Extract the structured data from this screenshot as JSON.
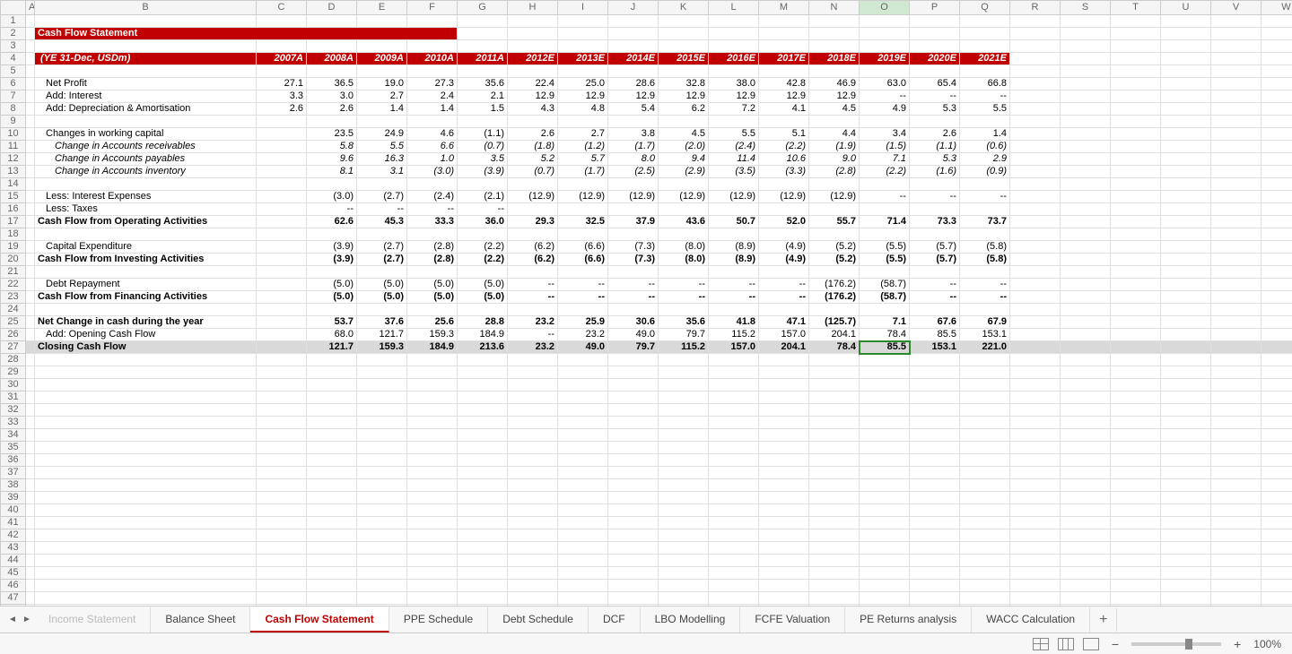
{
  "title": "Cash Flow Statement",
  "header_label": "(YE 31-Dec, USDm)",
  "years": [
    "2007A",
    "2008A",
    "2009A",
    "2010A",
    "2011A",
    "2012E",
    "2013E",
    "2014E",
    "2015E",
    "2016E",
    "2017E",
    "2018E",
    "2019E",
    "2020E",
    "2021E"
  ],
  "rows": [
    {
      "r": 6,
      "label": "Net Profit",
      "indent": 1,
      "vals": [
        "27.1",
        "36.5",
        "19.0",
        "27.3",
        "35.6",
        "22.4",
        "25.0",
        "28.6",
        "32.8",
        "38.0",
        "42.8",
        "46.9",
        "63.0",
        "65.4",
        "66.8"
      ]
    },
    {
      "r": 7,
      "label": "Add: Interest",
      "indent": 1,
      "vals": [
        "3.3",
        "3.0",
        "2.7",
        "2.4",
        "2.1",
        "12.9",
        "12.9",
        "12.9",
        "12.9",
        "12.9",
        "12.9",
        "12.9",
        "--",
        "--",
        "--"
      ]
    },
    {
      "r": 8,
      "label": "Add: Depreciation & Amortisation",
      "indent": 1,
      "vals": [
        "2.6",
        "2.6",
        "1.4",
        "1.4",
        "1.5",
        "4.3",
        "4.8",
        "5.4",
        "6.2",
        "7.2",
        "4.1",
        "4.5",
        "4.9",
        "5.3",
        "5.5"
      ]
    },
    {
      "r": 9,
      "blank": true
    },
    {
      "r": 10,
      "label": "Changes in working capital",
      "indent": 1,
      "vals": [
        "",
        "23.5",
        "24.9",
        "4.6",
        "(1.1)",
        "2.6",
        "2.7",
        "3.8",
        "4.5",
        "5.5",
        "5.1",
        "4.4",
        "3.4",
        "2.6",
        "1.4"
      ]
    },
    {
      "r": 11,
      "label": "Change in Accounts receivables",
      "indent": 2,
      "italic": true,
      "vals": [
        "",
        "5.8",
        "5.5",
        "6.6",
        "(0.7)",
        "(1.8)",
        "(1.2)",
        "(1.7)",
        "(2.0)",
        "(2.4)",
        "(2.2)",
        "(1.9)",
        "(1.5)",
        "(1.1)",
        "(0.6)"
      ]
    },
    {
      "r": 12,
      "label": "Change in Accounts payables",
      "indent": 2,
      "italic": true,
      "vals": [
        "",
        "9.6",
        "16.3",
        "1.0",
        "3.5",
        "5.2",
        "5.7",
        "8.0",
        "9.4",
        "11.4",
        "10.6",
        "9.0",
        "7.1",
        "5.3",
        "2.9"
      ]
    },
    {
      "r": 13,
      "label": "Change in Accounts inventory",
      "indent": 2,
      "italic": true,
      "vals": [
        "",
        "8.1",
        "3.1",
        "(3.0)",
        "(3.9)",
        "(0.7)",
        "(1.7)",
        "(2.5)",
        "(2.9)",
        "(3.5)",
        "(3.3)",
        "(2.8)",
        "(2.2)",
        "(1.6)",
        "(0.9)"
      ]
    },
    {
      "r": 14,
      "blank": true
    },
    {
      "r": 15,
      "label": "Less: Interest Expenses",
      "indent": 1,
      "vals": [
        "",
        "(3.0)",
        "(2.7)",
        "(2.4)",
        "(2.1)",
        "(12.9)",
        "(12.9)",
        "(12.9)",
        "(12.9)",
        "(12.9)",
        "(12.9)",
        "(12.9)",
        "--",
        "--",
        "--"
      ]
    },
    {
      "r": 16,
      "label": "Less: Taxes",
      "indent": 1,
      "vals": [
        "",
        "--",
        "--",
        "--",
        "--",
        "",
        "",
        "",
        "",
        "",
        "",
        "",
        "",
        "",
        ""
      ]
    },
    {
      "r": 17,
      "label": "Cash Flow from Operating Activities",
      "bold": true,
      "topline": true,
      "vals": [
        "",
        "62.6",
        "45.3",
        "33.3",
        "36.0",
        "29.3",
        "32.5",
        "37.9",
        "43.6",
        "50.7",
        "52.0",
        "55.7",
        "71.4",
        "73.3",
        "73.7"
      ]
    },
    {
      "r": 18,
      "blank": true
    },
    {
      "r": 19,
      "label": "Capital Expenditure",
      "indent": 1,
      "vals": [
        "",
        "(3.9)",
        "(2.7)",
        "(2.8)",
        "(2.2)",
        "(6.2)",
        "(6.6)",
        "(7.3)",
        "(8.0)",
        "(8.9)",
        "(4.9)",
        "(5.2)",
        "(5.5)",
        "(5.7)",
        "(5.8)"
      ]
    },
    {
      "r": 20,
      "label": "Cash Flow from Investing Activities",
      "bold": true,
      "topline": true,
      "vals": [
        "",
        "(3.9)",
        "(2.7)",
        "(2.8)",
        "(2.2)",
        "(6.2)",
        "(6.6)",
        "(7.3)",
        "(8.0)",
        "(8.9)",
        "(4.9)",
        "(5.2)",
        "(5.5)",
        "(5.7)",
        "(5.8)"
      ]
    },
    {
      "r": 21,
      "blank": true
    },
    {
      "r": 22,
      "label": "Debt Repayment",
      "indent": 1,
      "vals": [
        "",
        "(5.0)",
        "(5.0)",
        "(5.0)",
        "(5.0)",
        "--",
        "--",
        "--",
        "--",
        "--",
        "--",
        "(176.2)",
        "(58.7)",
        "--",
        "--"
      ]
    },
    {
      "r": 23,
      "label": "Cash Flow from Financing Activities",
      "bold": true,
      "topline": true,
      "vals": [
        "",
        "(5.0)",
        "(5.0)",
        "(5.0)",
        "(5.0)",
        "--",
        "--",
        "--",
        "--",
        "--",
        "--",
        "(176.2)",
        "(58.7)",
        "--",
        "--"
      ]
    },
    {
      "r": 24,
      "blank": true
    },
    {
      "r": 25,
      "label": "Net Change in cash during the year",
      "bold": true,
      "vals": [
        "",
        "53.7",
        "37.6",
        "25.6",
        "28.8",
        "23.2",
        "25.9",
        "30.6",
        "35.6",
        "41.8",
        "47.1",
        "(125.7)",
        "7.1",
        "67.6",
        "67.9"
      ]
    },
    {
      "r": 26,
      "label": "Add: Opening Cash Flow",
      "indent": 1,
      "vals": [
        "",
        "68.0",
        "121.7",
        "159.3",
        "184.9",
        "--",
        "23.2",
        "49.0",
        "79.7",
        "115.2",
        "157.0",
        "204.1",
        "78.4",
        "85.5",
        "153.1"
      ]
    },
    {
      "r": 27,
      "label": "Closing Cash Flow",
      "bold": true,
      "closing": true,
      "vals": [
        "",
        "121.7",
        "159.3",
        "184.9",
        "213.6",
        "23.2",
        "49.0",
        "79.7",
        "115.2",
        "157.0",
        "204.1",
        "78.4",
        "85.5",
        "153.1",
        "221.0"
      ]
    }
  ],
  "col_letters": [
    "A",
    "B",
    "C",
    "D",
    "E",
    "F",
    "G",
    "H",
    "I",
    "J",
    "K",
    "L",
    "M",
    "N",
    "O",
    "P",
    "Q",
    "R",
    "S",
    "T",
    "U",
    "V",
    "W"
  ],
  "active_col": "O",
  "active_row": 27,
  "tabs": [
    "Income Statement",
    "Balance Sheet",
    "Cash Flow Statement",
    "PPE Schedule",
    "Debt Schedule",
    "DCF",
    "LBO Modelling",
    "FCFE Valuation",
    "PE Returns analysis",
    "WACC Calculation"
  ],
  "active_tab": "Cash Flow Statement",
  "zoom": "100%",
  "max_row": 50
}
